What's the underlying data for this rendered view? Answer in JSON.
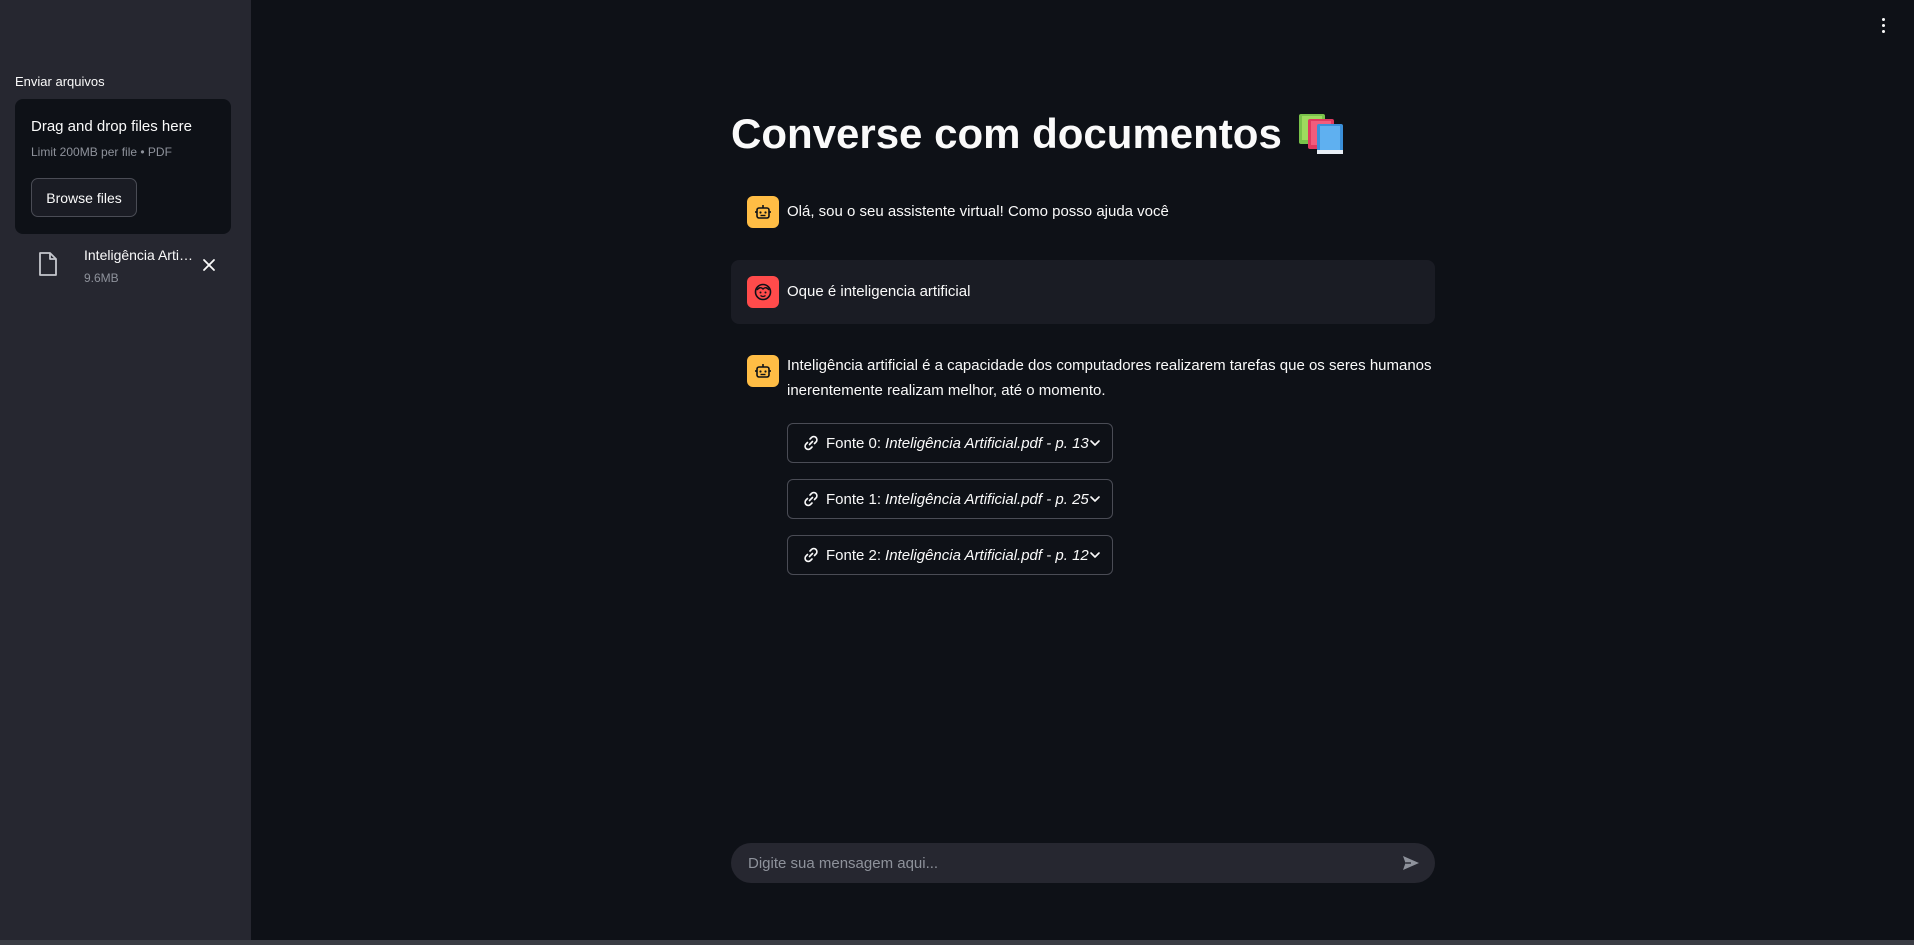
{
  "sidebar": {
    "upload_label": "Enviar arquivos",
    "dropzone": {
      "title": "Drag and drop files here",
      "limit": "Limit 200MB per file • PDF",
      "browse_label": "Browse files"
    },
    "uploaded_file": {
      "name": "Inteligência Artificial.pdf",
      "size": "9.6MB",
      "icon": "file-icon"
    }
  },
  "main": {
    "title": "Converse com documentos",
    "title_icon": "books-icon",
    "messages": [
      {
        "role": "assistant",
        "avatar": "bot-icon",
        "text": "Olá, sou o seu assistente virtual! Como posso ajuda você"
      },
      {
        "role": "user",
        "avatar": "user-face-icon",
        "text": "Oque é inteligencia artificial"
      },
      {
        "role": "assistant",
        "avatar": "bot-icon",
        "text": "Inteligência artificial é a capacidade dos computadores realizarem tarefas que os seres humanos inerentemente realizam melhor, até o momento.",
        "sources": [
          {
            "label": "Fonte 0:",
            "detail": "Inteligência Artificial.pdf - p. 13"
          },
          {
            "label": "Fonte 1:",
            "detail": "Inteligência Artificial.pdf - p. 25"
          },
          {
            "label": "Fonte 2:",
            "detail": "Inteligência Artificial.pdf - p. 12"
          }
        ]
      }
    ],
    "chat_input": {
      "placeholder": "Digite sua mensagem aqui..."
    }
  },
  "colors": {
    "background": "#0e1117",
    "sidebar": "#262730",
    "bot_avatar": "#ffbd45",
    "user_avatar": "#ff4b4b"
  }
}
